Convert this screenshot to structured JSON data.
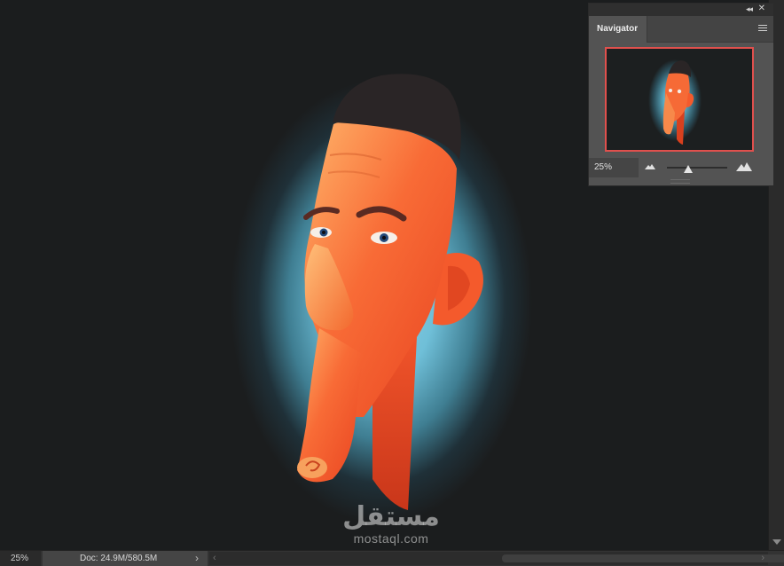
{
  "status_bar": {
    "zoom": "25%",
    "doc_info": "Doc: 24.9M/580.5M"
  },
  "navigator": {
    "tab_label": "Navigator",
    "zoom_value": "25%",
    "zoom_slider_level": 0.35
  },
  "watermark": {
    "arabic": "مستقل",
    "latin": "mostaql.com"
  },
  "colors": {
    "canvas_bg": "#1b1d1e",
    "glow": "#6fbfd8",
    "skin_orange": "#f4552a",
    "hair": "#2a2526",
    "nav_view_box": "#e0504d"
  },
  "icons": {
    "collapse": "double-chevron-left-icon",
    "close": "close-icon",
    "panel_menu": "hamburger-menu-icon",
    "zoom_out": "small-mountain-icon",
    "zoom_in": "large-mountain-icon"
  }
}
